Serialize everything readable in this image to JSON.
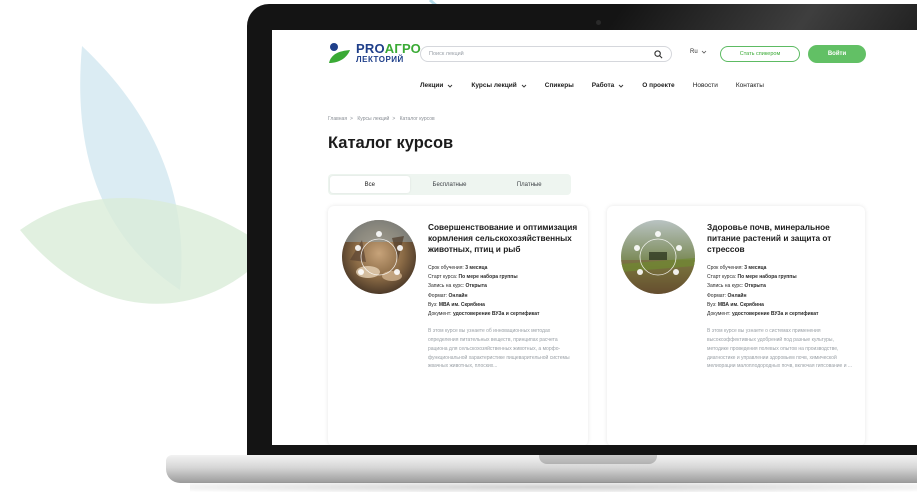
{
  "search": {
    "placeholder": "Поиск лекций"
  },
  "logo": {
    "brand_a": "PRO",
    "brand_b": "АГРО",
    "subtitle": "ЛЕКТОРИЙ"
  },
  "header": {
    "lang": "Ru",
    "become_speaker": "Стать спикером",
    "login": "Войти"
  },
  "nav": {
    "items": [
      {
        "label": "Лекции",
        "dropdown": true
      },
      {
        "label": "Курсы лекций",
        "dropdown": true
      },
      {
        "label": "Спикеры",
        "dropdown": false
      },
      {
        "label": "Работа",
        "dropdown": true
      },
      {
        "label": "О проекте",
        "dropdown": false
      },
      {
        "label": "Новости",
        "dropdown": false
      },
      {
        "label": "Контакты",
        "dropdown": false
      }
    ]
  },
  "breadcrumb": {
    "items": [
      "Главная",
      "Курсы лекций",
      "Каталог курсов"
    ],
    "separator": ">"
  },
  "page": {
    "title": "Каталог курсов"
  },
  "tabs": {
    "items": [
      "Все",
      "Бесплатные",
      "Платные"
    ],
    "active": 0
  },
  "cards": [
    {
      "title": "Совершенствование и оптимизация кормления сельскохозяйственных животных, птиц и рыб",
      "duration_label": "Срок обучения:",
      "duration": "3 месяца",
      "start_label": "Старт курса:",
      "start": "По мере набора группы",
      "enroll_label": "Запись на курс:",
      "enroll": "Открыта",
      "format_label": "Формат:",
      "format": "Онлайн",
      "uni_label": "Вуз:",
      "uni": "МВА им. Скрябина",
      "doc_label": "Документ:",
      "doc": "удостоверение ВУЗа и сертификат",
      "description": "В этом курсе вы узнаете об инновационных методах определения питательных веществ, принципах расчета рациона для сельскохозяйственных животных, а морфо-функциональной характеристике пищеварительной системы жвачных животных, плоских..."
    },
    {
      "title": "Здоровье почв, минеральное питание растений и защита от стрессов",
      "duration_label": "Срок обучения:",
      "duration": "3 месяца",
      "start_label": "Старт курса:",
      "start": "По мере набора группы",
      "enroll_label": "Запись на курс:",
      "enroll": "Открыта",
      "format_label": "Формат:",
      "format": "Онлайн",
      "uni_label": "Вуз:",
      "uni": "МВА им. Скрябина",
      "doc_label": "Документ:",
      "doc": "удостоверение ВУЗа и сертификат",
      "description": "В этом курсе вы узнаете о системах применения высокоэффективных удобрений под разные культуры, методике проведения полевых опытов на производстве, диагностике и управлении здоровьем почв, химической мелиорации малоплодородных почв, включая гипсование и ..."
    }
  ],
  "colors": {
    "brand_green": "#3aaa35",
    "brand_blue": "#1f3f8a",
    "button_green": "#62c065"
  }
}
